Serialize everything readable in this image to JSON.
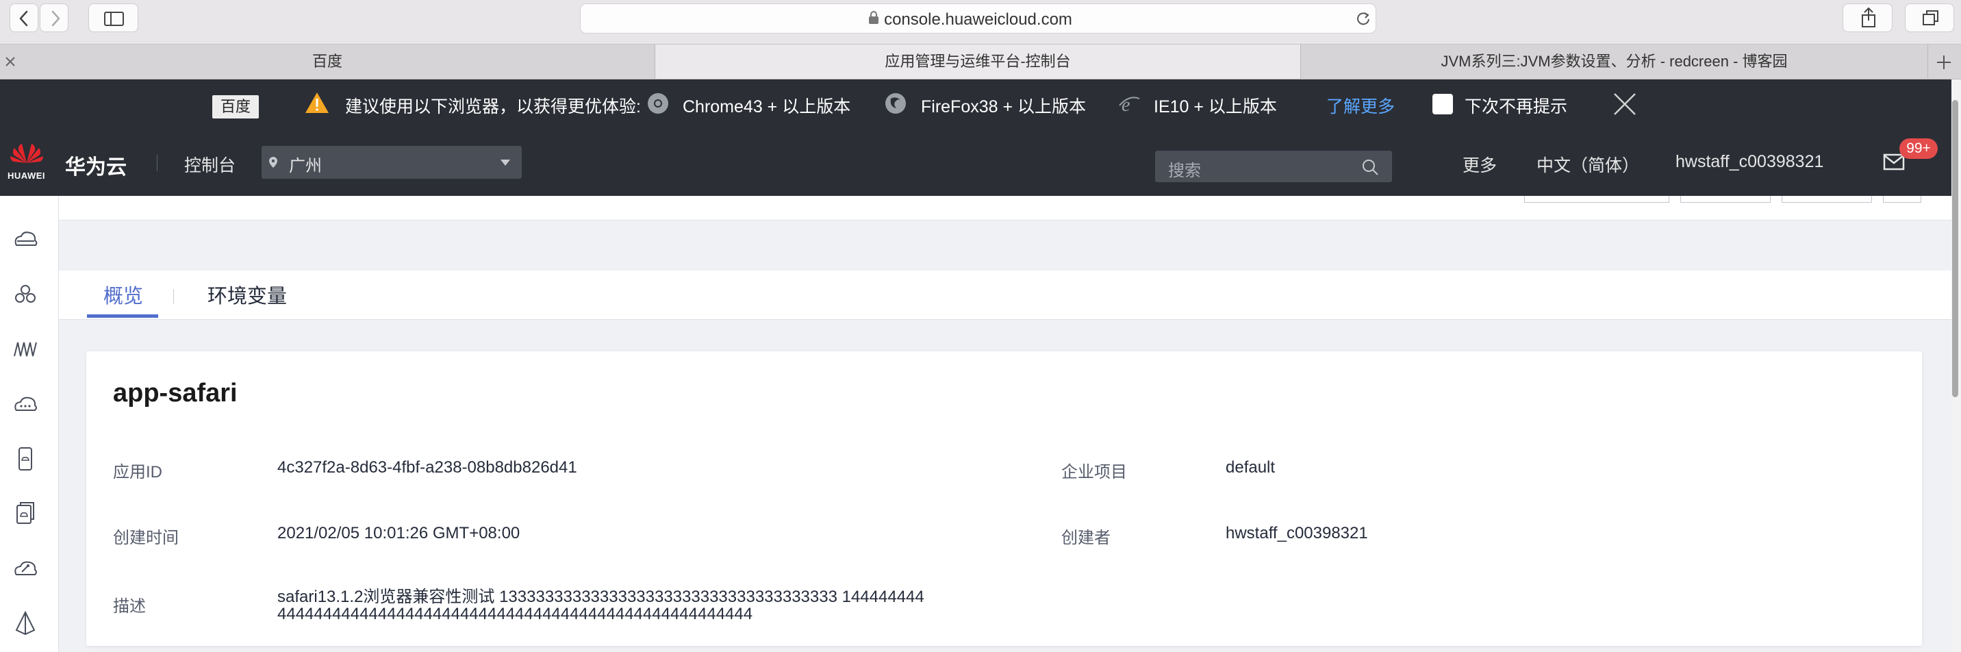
{
  "browser": {
    "url": "console.huaweicloud.com",
    "tabs": [
      {
        "label": "百度"
      },
      {
        "label": "应用管理与运维平台-控制台"
      },
      {
        "label": "JVM系列三:JVM参数设置、分析 - redcreen - 博客园"
      }
    ]
  },
  "notice": {
    "badge": "百度",
    "message": "建议使用以下浏览器，以获得更优体验:",
    "chrome": "Chrome43 + 以上版本",
    "firefox": "FireFox38 + 以上版本",
    "ie": "IE10 + 以上版本",
    "learn_more": "了解更多",
    "dont_show": "下次不再提示"
  },
  "header": {
    "logo_text": "HUAWEI",
    "brand": "华为云",
    "console": "控制台",
    "region": "广州",
    "search_placeholder": "搜索",
    "more": "更多",
    "language": "中文（简体）",
    "username": "hwstaff_c00398321",
    "messages_badge": "99+"
  },
  "content_tabs": [
    {
      "label": "概览"
    },
    {
      "label": "环境变量"
    }
  ],
  "app": {
    "name": "app-safari",
    "fields": {
      "app_id_label": "应用ID",
      "app_id": "4c327f2a-8d63-4fbf-a238-08b8db826d41",
      "project_label": "企业项目",
      "project": "default",
      "created_label": "创建时间",
      "created": "2021/02/05 10:01:26 GMT+08:00",
      "creator_label": "创建者",
      "creator": "hwstaff_c00398321",
      "desc_label": "描述",
      "desc_line1": "safari13.1.2浏览器兼容性测试 1333333333333333333333333333333333333 144444444",
      "desc_line2": "4444444444444444444444444444444444444444444444444444"
    }
  },
  "colors": {
    "accent": "#526ecc",
    "header_bg": "#2b2e35",
    "link": "#5ba6ff",
    "badge": "#e44b4b"
  }
}
